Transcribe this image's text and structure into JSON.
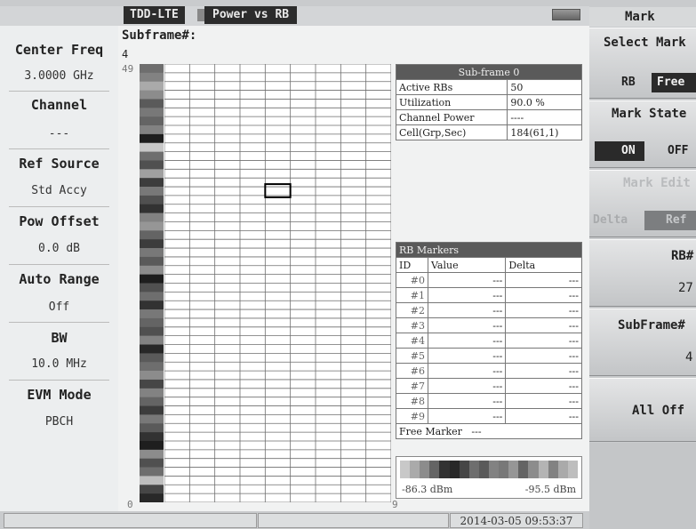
{
  "titlebar": {
    "mode": "TDD-LTE",
    "measurement": "Power vs RB"
  },
  "left_params": [
    {
      "label": "Center Freq",
      "value": "3.0000 GHz"
    },
    {
      "label": "Channel",
      "value": "---"
    },
    {
      "label": "Ref Source",
      "value": "Std Accy"
    },
    {
      "label": "Pow Offset",
      "value": "0.0 dB"
    },
    {
      "label": "Auto Range",
      "value": "Off"
    },
    {
      "label": "BW",
      "value": "10.0 MHz"
    },
    {
      "label": "EVM Mode",
      "value": "PBCH"
    }
  ],
  "main": {
    "subframe_label": "Subframe#:",
    "subframe_value": "4",
    "y_axis_top": "49",
    "y_axis_bottom": "0",
    "x_axis_right": "9",
    "subframe_table": {
      "title": "Sub-frame 0",
      "rows": [
        {
          "k": "Active RBs",
          "v": "50"
        },
        {
          "k": "Utilization",
          "v": "90.0 %"
        },
        {
          "k": "Channel Power",
          "v": "----"
        },
        {
          "k": "Cell(Grp,Sec)",
          "v": "184(61,1)"
        }
      ]
    },
    "rb_markers": {
      "title": "RB Markers",
      "headers": [
        "ID",
        "Value",
        "Delta"
      ],
      "rows": [
        {
          "id": "#0",
          "value": "---",
          "delta": "---"
        },
        {
          "id": "#1",
          "value": "---",
          "delta": "---"
        },
        {
          "id": "#2",
          "value": "---",
          "delta": "---"
        },
        {
          "id": "#3",
          "value": "---",
          "delta": "---"
        },
        {
          "id": "#4",
          "value": "---",
          "delta": "---"
        },
        {
          "id": "#5",
          "value": "---",
          "delta": "---"
        },
        {
          "id": "#6",
          "value": "---",
          "delta": "---"
        },
        {
          "id": "#7",
          "value": "---",
          "delta": "---"
        },
        {
          "id": "#8",
          "value": "---",
          "delta": "---"
        },
        {
          "id": "#9",
          "value": "---",
          "delta": "---"
        }
      ],
      "free_marker_label": "Free Marker",
      "free_marker_value": "---"
    },
    "legend": {
      "min": "-86.3 dBm",
      "max": "-95.5 dBm"
    },
    "colorbar_levels": [
      0.45,
      0.55,
      0.75,
      0.6,
      0.35,
      0.5,
      0.4,
      0.55,
      0.05,
      0.9,
      0.45,
      0.3,
      0.7,
      0.2,
      0.5,
      0.3,
      0.15,
      0.55,
      0.65,
      0.4,
      0.2,
      0.5,
      0.35,
      0.6,
      0.05,
      0.3,
      0.45,
      0.15,
      0.5,
      0.4,
      0.3,
      0.55,
      0.1,
      0.35,
      0.45,
      0.6,
      0.25,
      0.55,
      0.4,
      0.2,
      0.5,
      0.35,
      0.15,
      0.05,
      0.6,
      0.3,
      0.45,
      0.85,
      0.25,
      0.1
    ],
    "selected_cell": {
      "col": 4,
      "row": 14
    }
  },
  "status": {
    "datetime": "2014-03-05 09:53:37"
  },
  "right_panel": {
    "title": "Mark",
    "select_mark": "Select Mark",
    "select_options": [
      "RB",
      "Free"
    ],
    "mark_state": "Mark State",
    "state_options": [
      "ON",
      "OFF"
    ],
    "mark_edit": "Mark Edit",
    "edit_options": [
      "Delta",
      "Ref"
    ],
    "rb_label": "RB#",
    "rb_value": "27",
    "subframe_label": "SubFrame#",
    "subframe_value": "4",
    "all_off": "All Off"
  },
  "colors": {
    "bar": "#2c2c2c",
    "panel": "#eceeef",
    "plot_bg": "#f1f2f2"
  }
}
